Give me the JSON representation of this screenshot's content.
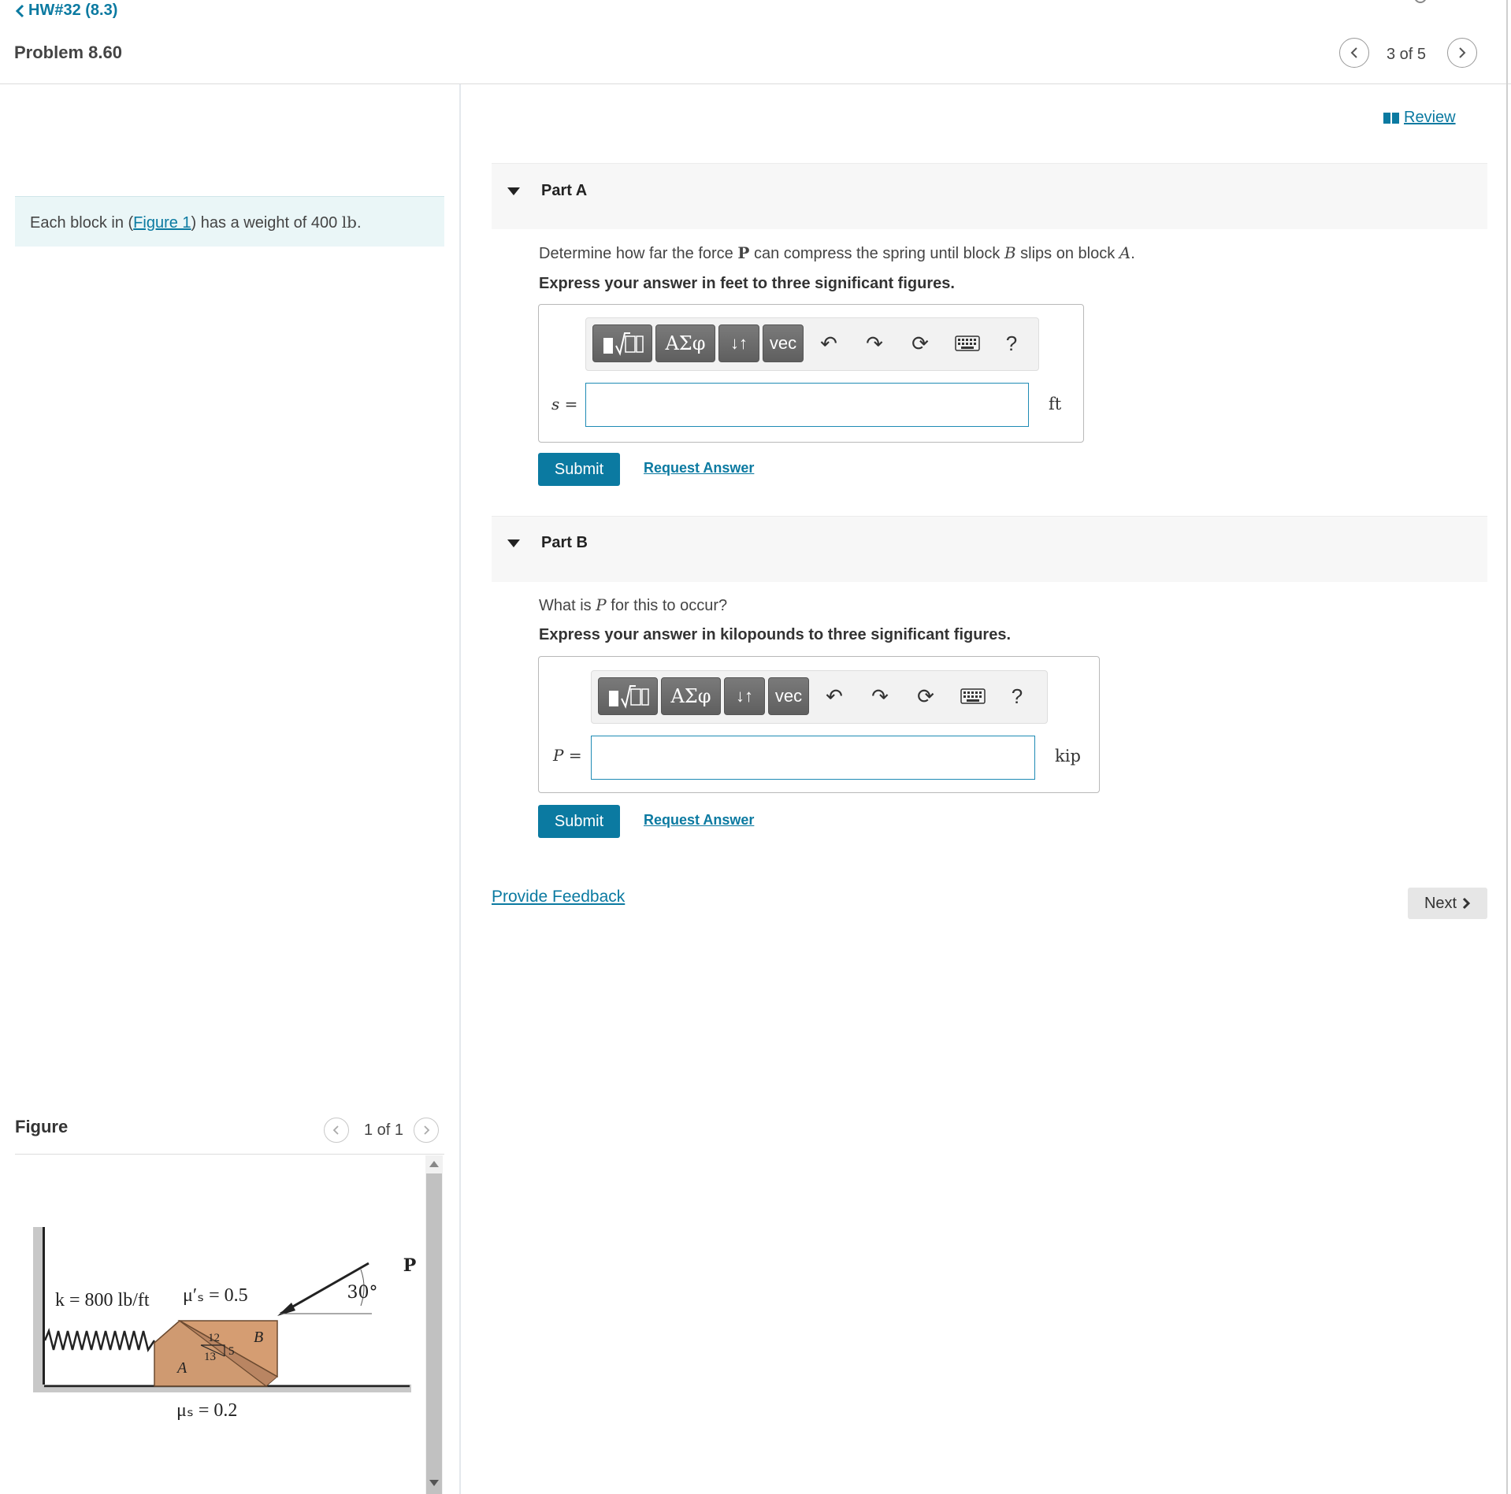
{
  "header": {
    "back_label": "HW#32 (8.3)",
    "problem_title": "Problem 8.60",
    "page_count": "3 of 5"
  },
  "intro": {
    "prefix": "Each block in (",
    "figure_link": "Figure 1",
    "middle": ") has a weight of 400 ",
    "unit": "lb",
    "suffix": "."
  },
  "figure": {
    "heading": "Figure",
    "count": "1 of 1",
    "labels": {
      "spring": "k = 800 lb/ft",
      "mu_top": "μ′ₛ = 0.5",
      "mu_bottom": "μₛ = 0.2",
      "force": "P",
      "angle": "30°",
      "block_a": "A",
      "block_b": "B",
      "slope_12": "12",
      "slope_5": "5",
      "slope_13": "13"
    }
  },
  "review_label": "Review",
  "parts": [
    {
      "title": "Part A",
      "q_prefix": "Determine how far the force ",
      "q_p": "P",
      "q_mid": " can compress the spring until block ",
      "q_b": "B",
      "q_mid2": " slips on block ",
      "q_a": "A",
      "q_end": ".",
      "instruction": "Express your answer in feet to three significant figures.",
      "var": "s =",
      "unit": "ft",
      "submit": "Submit",
      "request": "Request Answer"
    },
    {
      "title": "Part B",
      "q_prefix": "What is ",
      "q_p": "P",
      "q_end": " for this to occur?",
      "instruction": "Express your answer in kilopounds to three significant figures.",
      "var": "P =",
      "unit": "kip",
      "submit": "Submit",
      "request": "Request Answer"
    }
  ],
  "toolbar": {
    "greek": "ΑΣφ",
    "vec": "vec",
    "help": "?"
  },
  "footer": {
    "feedback": "Provide Feedback",
    "next": "Next"
  }
}
